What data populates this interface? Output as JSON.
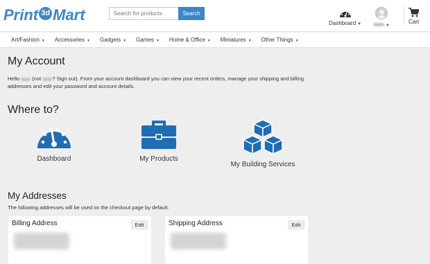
{
  "brand": {
    "logo_part1": "Print",
    "logo_badge": "3d",
    "logo_part2": "Mart",
    "color": "#3d86c6"
  },
  "search": {
    "placeholder": "Search for products",
    "button_label": "Search"
  },
  "header": {
    "dashboard_label": "Dashboard",
    "dashboard_icon": "speedometer-icon",
    "user_icon": "avatar-icon",
    "cart_label": "Cart",
    "cart_icon": "cart-icon"
  },
  "nav": {
    "items": [
      {
        "label": "Art/Fashion"
      },
      {
        "label": "Accessories"
      },
      {
        "label": "Gadgets"
      },
      {
        "label": "Games"
      },
      {
        "label": "Home & Office"
      },
      {
        "label": "Miniatures"
      },
      {
        "label": "Other Things"
      }
    ]
  },
  "account": {
    "title": "My Account",
    "intro_hello": "Hello",
    "intro_not": "(not",
    "intro_signout": "? Sign out). From your account dashboard you can view your recent orders, manage your shipping and billing addresses and edit your password and account details."
  },
  "where": {
    "title": "Where to?",
    "tiles": [
      {
        "label": "Dashboard",
        "icon": "speedometer-icon"
      },
      {
        "label": "My Products",
        "icon": "briefcase-icon"
      },
      {
        "label": "My Building Services",
        "icon": "cubes-icon"
      }
    ]
  },
  "addresses": {
    "title": "My Addresses",
    "note": "The following addresses will be used on the checkout page by default.",
    "billing": {
      "title": "Billing Address",
      "edit_label": "Edit"
    },
    "shipping": {
      "title": "Shipping Address",
      "edit_label": "Edit"
    }
  }
}
